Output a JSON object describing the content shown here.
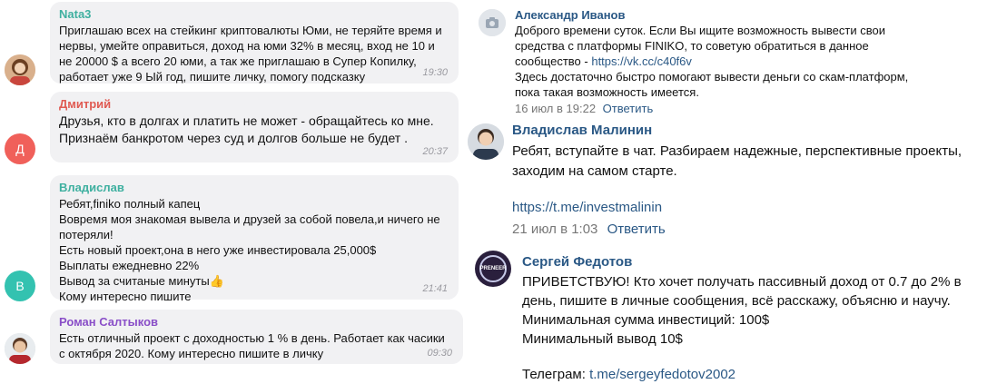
{
  "left_chat": [
    {
      "author": "Nata3",
      "author_color": "#3fb0a0",
      "text": "Приглашаю всех на стейкинг криптовалюты Юми, не теряйте время и\nнервы, умейте оправиться, доход на юми 32% в месяц, вход не 10 и\nне 20000 $ а всего 20 юми, а так же приглашаю в Супер Копилку,\nработает уже 9 Ый год, пишите личку, помогу подсказку",
      "time": "19:30"
    },
    {
      "author": "Дмитрий",
      "author_color": "#e05a52",
      "avatar_letter": "Д",
      "avatar_color": "#f0605a",
      "text": "Друзья, кто в долгах и платить не может - обращайтесь ко мне.\nПризнаём банкротом через суд и долгов больше не будет .",
      "time": "20:37"
    },
    {
      "author": "Владислав",
      "author_color": "#3fb0a0",
      "avatar_letter": "В",
      "avatar_color": "#33c2b0",
      "text": "Ребят,finiko полный капец\nВовремя моя знакомая вывела и друзей за собой повела,и ничего не\nпотеряли!\nЕсть новый проект,она в него уже инвестировала 25,000$\nВыплаты ежедневно 22%\nВывод за считаные минуты👍\nКому интересно пишите",
      "time": "21:41"
    },
    {
      "author": "Роман Салтыков",
      "author_color": "#8a4fc8",
      "text": "Есть отличный проект с доходностью 1 % в день. Работает как часики\nс октября 2020. Кому интересно пишите в личку",
      "time": "09:30"
    }
  ],
  "right_comments": [
    {
      "author": "Александр Иванов",
      "text1": "Доброго времени суток. Если Вы ищите возможность вывести свои\nсредства с платформы FINIKO, то советую обратиться в данное\nсообщество - ",
      "link": "https://vk.cc/c40f6v",
      "text2": "Здесь достаточно быстро помогают вывести деньги со скам-платформ,\nпока такая возможность имеется.",
      "date": "16 июл в 19:22",
      "reply": "Ответить"
    },
    {
      "author": "Владислав Малинин",
      "text": "Ребят, вступайте в чат. Разбираем надежные, перспективные проекты,\nзаходим на самом старте.",
      "link": "https://t.me/investmalinin",
      "date": "21 июл в 1:03",
      "reply": "Ответить"
    },
    {
      "author": "Сергей Федотов",
      "avatar_text": "PRENEER",
      "text": "ПРИВЕТСТВУЮ! Кто хочет получать пассивный доход от 0.7 до 2% в\nдень, пишите в личные сообщения, всё расскажу, объясню и научу.\nМинимальная сумма инвестиций: 100$\nМинимальный вывод 10$",
      "telegram_label": "Телеграм: ",
      "telegram_link": "t.me/sergeyfedotov2002"
    }
  ]
}
